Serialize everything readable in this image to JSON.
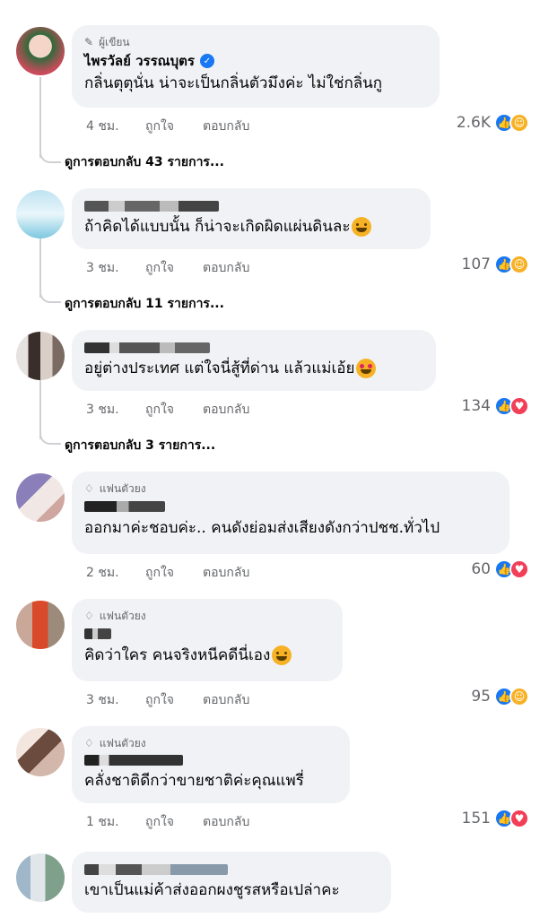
{
  "comments": [
    {
      "badge": "ผู้เขียน",
      "author": "ไพรวัลย์ วรรณบุตร",
      "text": "กลิ่นตุตุนั่น น่าจะเป็นกลิ่นตัวมึงค่ะ ไม่ใช่กลิ่นกู",
      "time": "4 ชม.",
      "like": "ถูกใจ",
      "reply": "ตอบกลับ",
      "reaction_count": "2.6K",
      "view_replies": "ดูการตอบกลับ 43 รายการ..."
    },
    {
      "badge": "",
      "author": "",
      "text": "ถ้าคิดได้แบบนั้น ก็น่าจะเกิดผิดแผ่นดินละ",
      "time": "3 ชม.",
      "like": "ถูกใจ",
      "reply": "ตอบกลับ",
      "reaction_count": "107",
      "view_replies": "ดูการตอบกลับ 11 รายการ..."
    },
    {
      "badge": "",
      "author": "",
      "text": "อยู่ต่างประเทศ แต่ใจนี่สู้ที่ด่าน แล้วแม่เอ้ย",
      "time": "3 ชม.",
      "like": "ถูกใจ",
      "reply": "ตอบกลับ",
      "reaction_count": "134",
      "view_replies": "ดูการตอบกลับ 3 รายการ..."
    },
    {
      "badge": "แฟนตัวยง",
      "author": "",
      "text": "ออกมาค่ะชอบค่ะ.. คนดังย่อมส่งเสียงดังกว่าปชช.ทั่วไป",
      "time": "2 ชม.",
      "like": "ถูกใจ",
      "reply": "ตอบกลับ",
      "reaction_count": "60"
    },
    {
      "badge": "แฟนตัวยง",
      "author": "",
      "text": "คิดว่าใคร คนจริงหนีคดีนี่เอง",
      "time": "3 ชม.",
      "like": "ถูกใจ",
      "reply": "ตอบกลับ",
      "reaction_count": "95"
    },
    {
      "badge": "แฟนตัวยง",
      "author": "",
      "text": "คลั่งชาติดีกว่าขายชาติค่ะคุณแพรี่",
      "time": "1 ชม.",
      "like": "ถูกใจ",
      "reply": "ตอบกลับ",
      "reaction_count": "151"
    },
    {
      "badge": "",
      "author": "",
      "text": "เขาเป็นแม่ค้าส่งออกผงชูรสหรือเปล่าคะ"
    }
  ],
  "colors": {
    "like_blue": "#1877f2",
    "haha_yellow": "#f7b125",
    "love_red": "#f33e58",
    "bubble_bg": "#f0f2f5",
    "meta_gray": "#65676b"
  }
}
